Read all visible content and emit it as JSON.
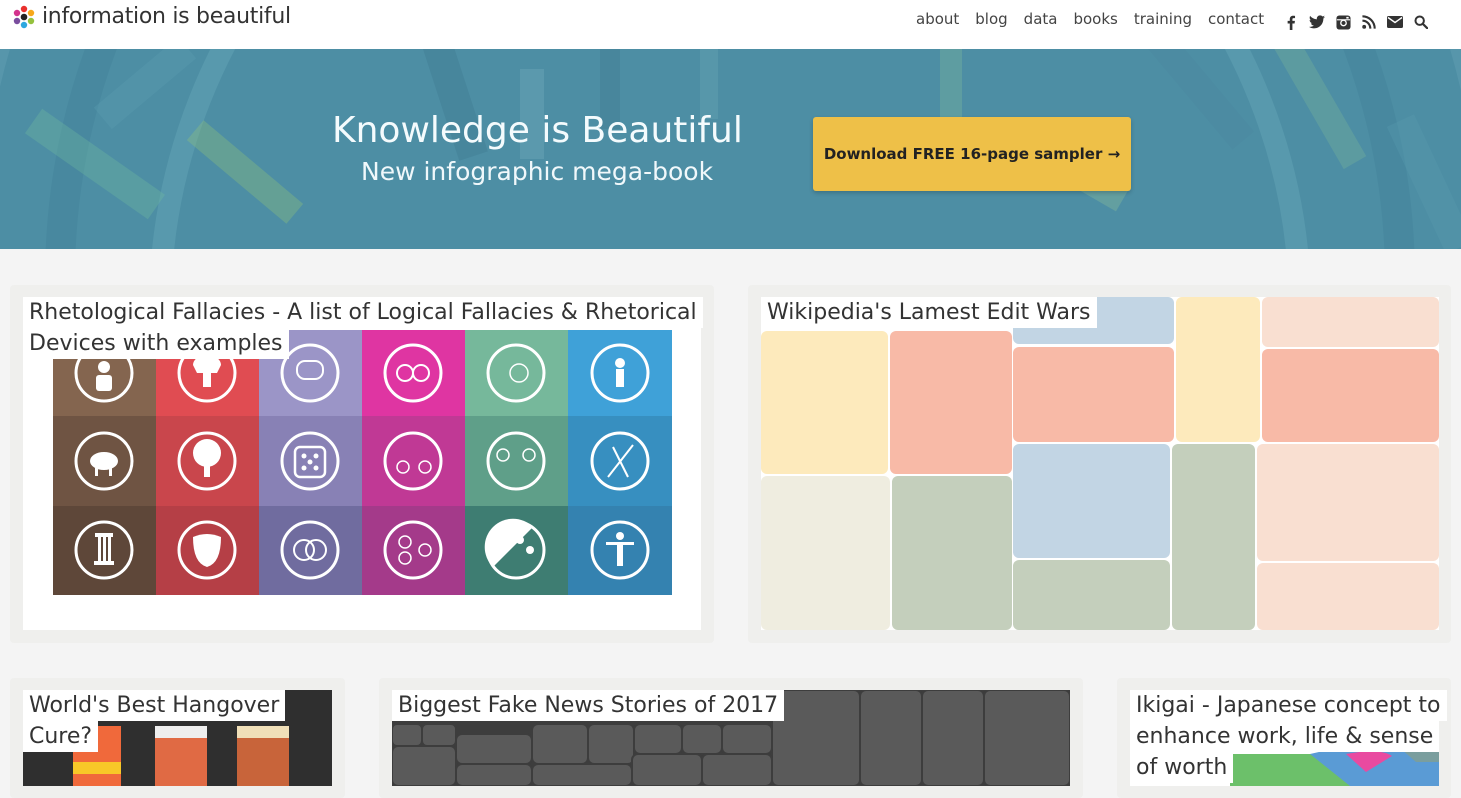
{
  "site": {
    "title": "information is beautiful"
  },
  "nav": {
    "items": [
      "about",
      "blog",
      "data",
      "books",
      "training",
      "contact"
    ]
  },
  "social": {
    "icons": [
      "facebook-icon",
      "twitter-icon",
      "instagram-icon",
      "rss-icon",
      "mail-icon",
      "search-icon"
    ]
  },
  "hero": {
    "title": "Knowledge is Beautiful",
    "subtitle": "New infographic mega-book",
    "cta": "Download FREE 16-page sampler →"
  },
  "cards": [
    {
      "title_lines": [
        "Rhetological Fallacies - A list of Logical Fallacies & Rhetorical",
        "Devices with examples"
      ]
    },
    {
      "title_lines": [
        "Wikipedia's Lamest Edit Wars"
      ]
    },
    {
      "title_lines": [
        "World's Best Hangover",
        "Cure?"
      ]
    },
    {
      "title_lines": [
        "Biggest Fake News Stories of 2017"
      ]
    },
    {
      "title_lines": [
        "Ikigai - Japanese concept to",
        "enhance work, life & sense",
        "of worth"
      ]
    }
  ],
  "colors": {
    "hero_bg": "#4a8ea5",
    "cta_bg": "#eec048",
    "fallacy_cols": [
      "#7a5a45",
      "#d94a4f",
      "#8d86b8",
      "#d1399c",
      "#6aa88f",
      "#3d90c8"
    ]
  }
}
